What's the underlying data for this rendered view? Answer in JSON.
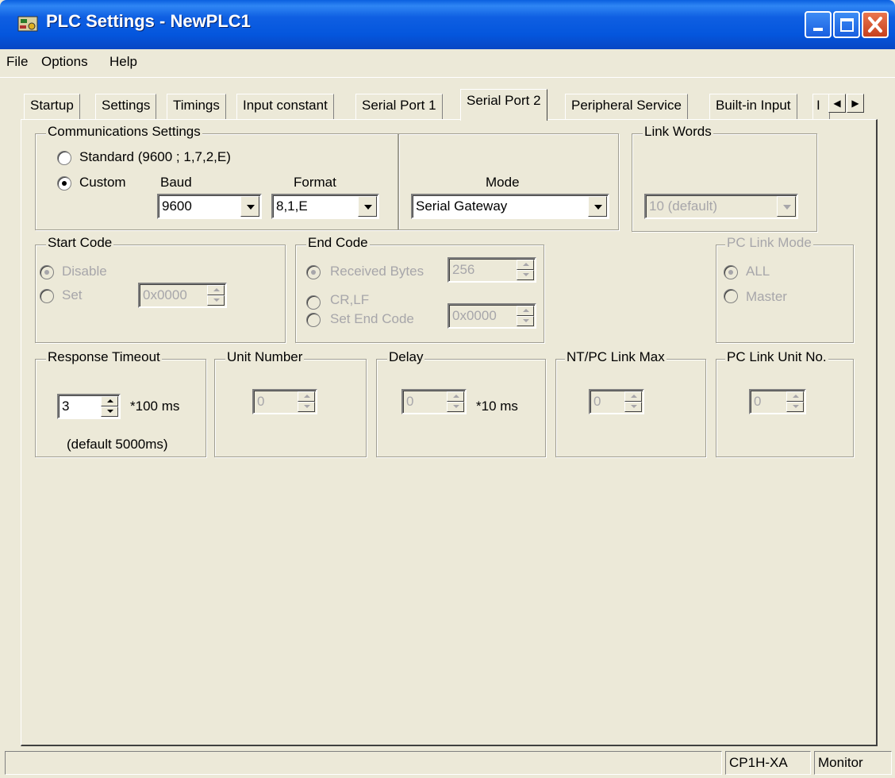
{
  "window": {
    "title": "PLC Settings - NewPLC1",
    "icon": "plc-app-icon",
    "controls": [
      "minimize-icon",
      "maximize-icon",
      "close-icon"
    ]
  },
  "menu": {
    "file": "File",
    "options": "Options",
    "help": "Help"
  },
  "tabs": [
    "Startup",
    "Settings",
    "Timings",
    "Input constant",
    "Serial Port 1",
    "Serial Port 2",
    "Peripheral Service",
    "Built-in Input",
    "I"
  ],
  "active_tab": "Serial Port 2",
  "comm": {
    "legend": "Communications Settings",
    "standard_label": "Standard (9600 ; 1,7,2,E)",
    "custom_label": "Custom",
    "selected": "Custom",
    "baud_label": "Baud",
    "baud_value": "9600",
    "format_label": "Format",
    "format_value": "8,1,E",
    "mode_label": "Mode",
    "mode_value": "Serial Gateway"
  },
  "link_words": {
    "legend": "Link Words",
    "value": "10 (default)"
  },
  "start_code": {
    "legend": "Start Code",
    "disable_label": "Disable",
    "set_label": "Set",
    "selected": "Disable",
    "value": "0x0000"
  },
  "end_code": {
    "legend": "End Code",
    "received_label": "Received Bytes",
    "received_value": "256",
    "crlf_label": "CR,LF",
    "set_end_label": "Set End Code",
    "selected": "Received Bytes",
    "set_end_value": "0x0000"
  },
  "pc_link_mode": {
    "legend": "PC Link Mode",
    "all_label": "ALL",
    "master_label": "Master",
    "selected": "ALL"
  },
  "response_timeout": {
    "legend": "Response Timeout",
    "value": "3",
    "unit": "*100 ms",
    "note": "(default 5000ms)"
  },
  "unit_number": {
    "legend": "Unit Number",
    "value": "0"
  },
  "delay": {
    "legend": "Delay",
    "value": "0",
    "unit": "*10 ms"
  },
  "nt_pc_link_max": {
    "legend": "NT/PC Link Max",
    "value": "0"
  },
  "pc_link_unit_no": {
    "legend": "PC Link Unit No.",
    "value": "0"
  },
  "status": {
    "model": "CP1H-XA",
    "mode": "Monitor"
  }
}
